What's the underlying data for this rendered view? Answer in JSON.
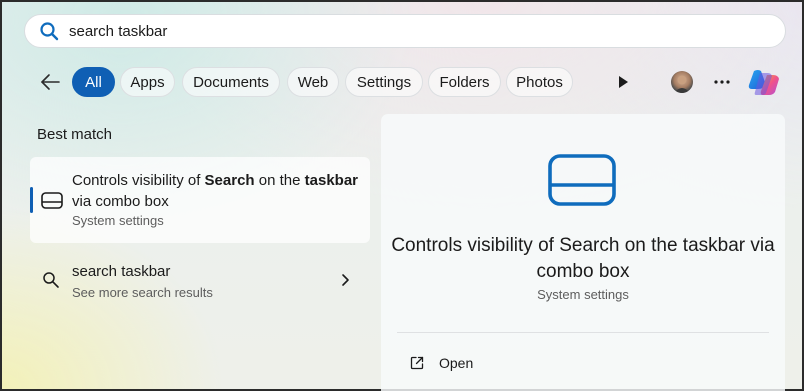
{
  "search": {
    "value": "search taskbar",
    "icon": "search-icon"
  },
  "filters": {
    "items": [
      {
        "label": "All",
        "active": true
      },
      {
        "label": "Apps",
        "active": false
      },
      {
        "label": "Documents",
        "active": false
      },
      {
        "label": "Web",
        "active": false
      },
      {
        "label": "Settings",
        "active": false
      },
      {
        "label": "Folders",
        "active": false
      },
      {
        "label": "Photos",
        "active": false
      }
    ],
    "accent_color": "#0f5fb4"
  },
  "results": {
    "best_match_heading": "Best match",
    "best_match": {
      "title_parts": [
        "Controls visibility of ",
        "Search",
        " on the ",
        "taskbar",
        " via combo box"
      ],
      "subtitle": "System settings",
      "icon": "taskbar-settings-icon"
    },
    "web_result": {
      "title": "search taskbar",
      "subtitle": "See more search results",
      "icon": "search-icon"
    }
  },
  "detail": {
    "title": "Controls visibility of Search on the taskbar via combo box",
    "subtitle": "System settings",
    "icon": "taskbar-settings-icon",
    "actions": [
      {
        "label": "Open",
        "icon": "open-external-icon"
      }
    ]
  }
}
